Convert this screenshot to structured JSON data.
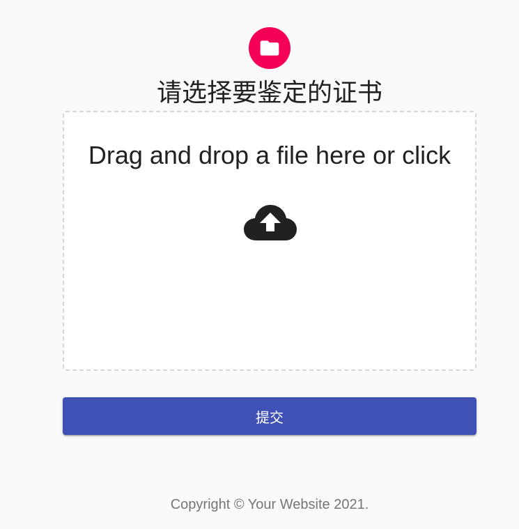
{
  "header": {
    "icon": "folder-icon",
    "icon_bg_color": "#f50057",
    "title": "请选择要鉴定的证书"
  },
  "dropzone": {
    "prompt": "Drag and drop a file here or click",
    "icon": "cloud-upload-icon"
  },
  "form": {
    "submit_label": "提交",
    "submit_color": "#3f51b5"
  },
  "footer": {
    "copyright": "Copyright © Your Website 2021."
  }
}
